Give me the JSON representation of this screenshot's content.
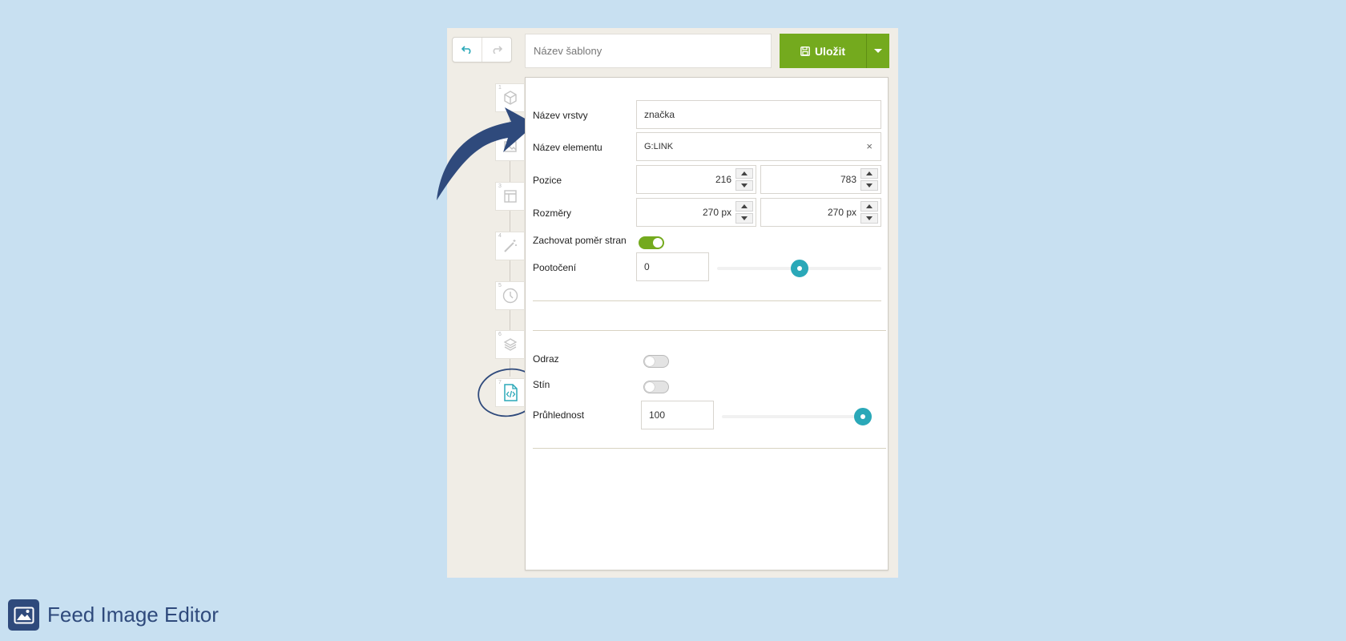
{
  "header": {
    "template_placeholder": "Název šablony",
    "save_label": "Uložit"
  },
  "steps": [
    {
      "num": "1",
      "icon": "cube-icon"
    },
    {
      "num": "2",
      "icon": "image-icon"
    },
    {
      "num": "3",
      "icon": "layout-icon"
    },
    {
      "num": "4",
      "icon": "magic-wand-icon"
    },
    {
      "num": "5",
      "icon": "clock-icon"
    },
    {
      "num": "6",
      "icon": "layers-icon"
    },
    {
      "num": "7",
      "icon": "code-file-icon"
    }
  ],
  "properties": {
    "layer_name_label": "Název vrstvy",
    "layer_name_value": "značka",
    "element_name_label": "Název elementu",
    "element_name_value": "G:LINK",
    "position_label": "Pozice",
    "position_x": "216",
    "position_y": "783",
    "size_label": "Rozměry",
    "size_w": "270 px",
    "size_h": "270 px",
    "keep_ratio_label": "Zachovat poměr stran",
    "keep_ratio_on": true,
    "rotation_label": "Pootočení",
    "rotation_value": "0",
    "rotation_slider": 0.5,
    "reflection_label": "Odraz",
    "reflection_on": false,
    "shadow_label": "Stín",
    "shadow_on": false,
    "opacity_label": "Průhlednost",
    "opacity_value": "100",
    "opacity_slider": 1.0
  },
  "footer": {
    "title": "Feed Image Editor"
  },
  "colors": {
    "accent_green": "#74aa1e",
    "accent_teal": "#2aa8b8",
    "brand_navy": "#2f4a7c"
  }
}
